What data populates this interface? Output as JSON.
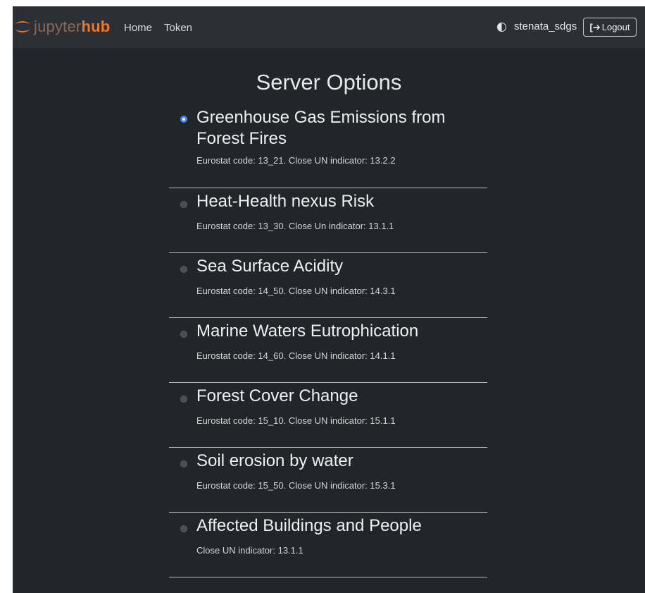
{
  "navbar": {
    "logo_text_1": "jupyter",
    "logo_text_2": "hub",
    "links": [
      "Home",
      "Token"
    ],
    "username": "stenata_sdgs",
    "logout_label": "Logout"
  },
  "page": {
    "title": "Server Options"
  },
  "options": [
    {
      "title": "Greenhouse Gas Emissions from Forest Fires",
      "desc": "Eurostat code: 13_21. Close UN indicator: 13.2.2",
      "selected": true
    },
    {
      "title": "Heat-Health nexus Risk",
      "desc": "Eurostat code: 13_30. Close Un indicator: 13.1.1",
      "selected": false
    },
    {
      "title": "Sea Surface Acidity",
      "desc": "Eurostat code: 14_50. Close UN indicator: 14.3.1",
      "selected": false
    },
    {
      "title": "Marine Waters Eutrophication",
      "desc": "Eurostat code: 14_60. Close UN indicator: 14.1.1",
      "selected": false
    },
    {
      "title": "Forest Cover Change",
      "desc": "Eurostat code: 15_10. Close UN indicator: 15.1.1",
      "selected": false
    },
    {
      "title": "Soil erosion by water",
      "desc": "Eurostat code: 15_50. Close UN indicator: 15.3.1",
      "selected": false
    },
    {
      "title": "Affected Buildings and People",
      "desc": "Close UN indicator: 13.1.1",
      "selected": false
    }
  ],
  "colors": {
    "background": "#222529",
    "navbar": "#2c3036",
    "accent": "#f37726",
    "radio_selected": "#3d8bfd"
  }
}
